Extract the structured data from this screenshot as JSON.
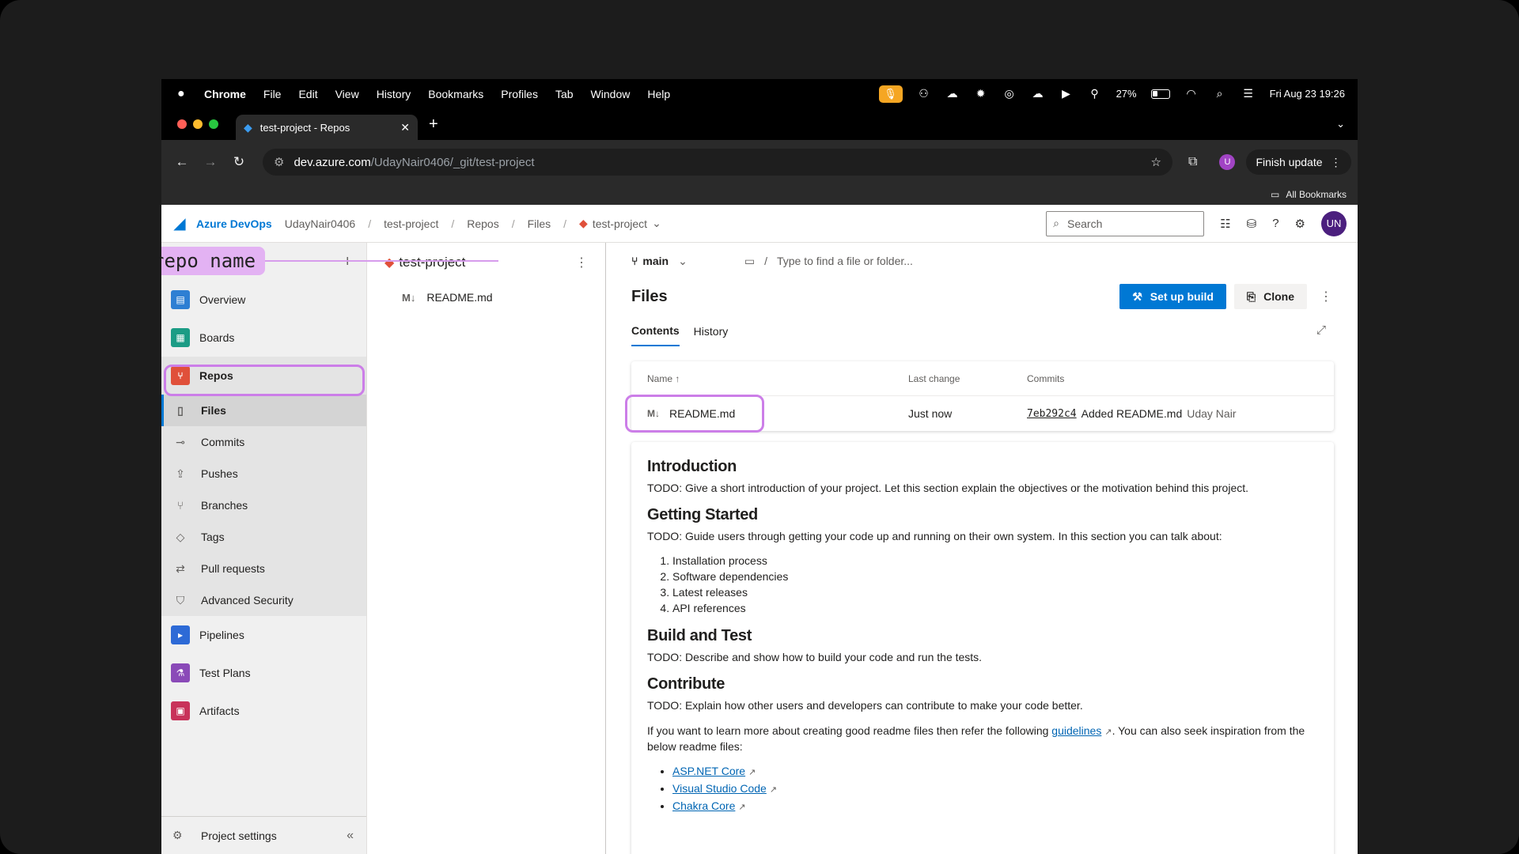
{
  "menubar": {
    "app": "Chrome",
    "items": [
      "File",
      "Edit",
      "View",
      "History",
      "Bookmarks",
      "Profiles",
      "Tab",
      "Window",
      "Help"
    ],
    "battery": "27%",
    "datetime": "Fri Aug 23  19:26"
  },
  "browser": {
    "tab_title": "test-project - Repos",
    "url_domain": "dev.azure.com",
    "url_path": "/UdayNair0406/_git/test-project",
    "profile_initial": "U",
    "finish_update": "Finish update",
    "all_bookmarks": "All Bookmarks"
  },
  "ado": {
    "product": "Azure DevOps",
    "breadcrumbs": [
      "UdayNair0406",
      "test-project",
      "Repos",
      "Files"
    ],
    "repo_crumb": "test-project",
    "search_placeholder": "Search",
    "user_initials": "UN"
  },
  "nav": {
    "overview": "Overview",
    "boards": "Boards",
    "repos": "Repos",
    "sub": [
      "Files",
      "Commits",
      "Pushes",
      "Branches",
      "Tags",
      "Pull requests",
      "Advanced Security"
    ],
    "pipelines": "Pipelines",
    "testplans": "Test Plans",
    "artifacts": "Artifacts",
    "settings": "Project settings"
  },
  "annotation": {
    "label": "repo name",
    "color": "#cc7ee8"
  },
  "tree": {
    "repo": "test-project",
    "file": "README.md"
  },
  "main": {
    "branch": "main",
    "path_placeholder": "Type to find a file or folder...",
    "title": "Files",
    "setup_build": "Set up build",
    "clone": "Clone",
    "tabs": [
      "Contents",
      "History"
    ],
    "table": {
      "headers": [
        "Name ↑",
        "Last change",
        "Commits"
      ],
      "row": {
        "name": "README.md",
        "last_change": "Just now",
        "sha": "7eb292c4",
        "message": "Added README.md",
        "author": "Uday Nair"
      }
    }
  },
  "readme": {
    "h_intro": "Introduction",
    "p_intro": "TODO: Give a short introduction of your project. Let this section explain the objectives or the motivation behind this project.",
    "h_start": "Getting Started",
    "p_start": "TODO: Guide users through getting your code up and running on their own system. In this section you can talk about:",
    "steps": [
      "Installation process",
      "Software dependencies",
      "Latest releases",
      "API references"
    ],
    "h_build": "Build and Test",
    "p_build": "TODO: Describe and show how to build your code and run the tests.",
    "h_contrib": "Contribute",
    "p_contrib": "TODO: Explain how other users and developers can contribute to make your code better.",
    "p_more_a": "If you want to learn more about creating good readme files then refer the following ",
    "link_guidelines": "guidelines",
    "p_more_b": ". You can also seek inspiration from the below readme files:",
    "links": [
      "ASP.NET Core",
      "Visual Studio Code",
      "Chakra Core"
    ]
  }
}
